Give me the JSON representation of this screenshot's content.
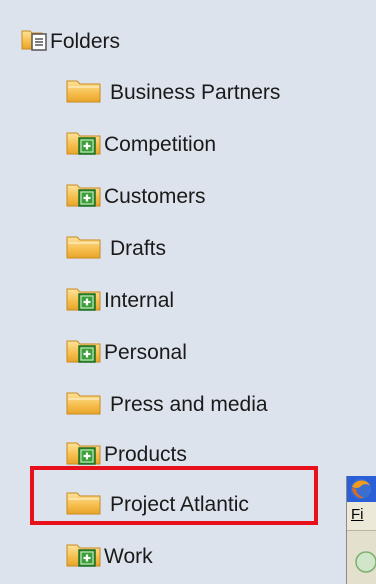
{
  "tree": {
    "root_label": "Folders",
    "items": [
      {
        "label": "Business Partners",
        "expandable": false
      },
      {
        "label": "Competition",
        "expandable": true
      },
      {
        "label": "Customers",
        "expandable": true
      },
      {
        "label": "Drafts",
        "expandable": false
      },
      {
        "label": "Internal",
        "expandable": true
      },
      {
        "label": "Personal",
        "expandable": true
      },
      {
        "label": "Press and media",
        "expandable": false
      },
      {
        "label": "Products",
        "expandable": true
      },
      {
        "label": "Project Atlantic",
        "expandable": false,
        "highlighted": true
      },
      {
        "label": "Work",
        "expandable": true
      }
    ]
  },
  "background_window": {
    "menu_letter": "Fi"
  },
  "colors": {
    "background": "#dde3ec",
    "folder": "#f5b73a",
    "expand_badge": "#3aa13a",
    "highlight_border": "#e8101a"
  }
}
